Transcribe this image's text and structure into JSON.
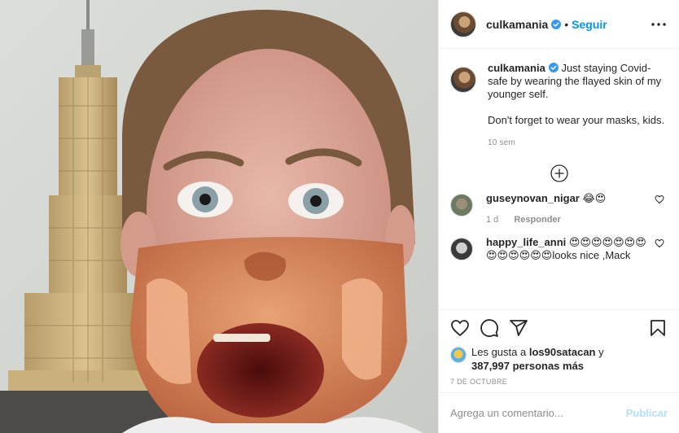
{
  "header": {
    "username": "culkamania",
    "separator": "•",
    "follow_label": "Seguir"
  },
  "caption": {
    "username": "culkamania",
    "text_line1": "Just staying Covid-safe by wearing the flayed skin of my younger self.",
    "text_line2": "Don't forget to wear your masks, kids.",
    "age": "10 sem"
  },
  "comments": [
    {
      "username": "guseynovan_nigar",
      "text": "😂😍",
      "age": "1 d",
      "reply_label": "Responder"
    },
    {
      "username": "happy_life_anni",
      "text": "😍😍😍😍😍😍😍😍😍😍😍😍😍looks nice ,Mack"
    }
  ],
  "likes": {
    "prefix": "Les gusta a ",
    "user": "los90satacan",
    "suffix": " y",
    "count": "387,997 personas más"
  },
  "post_date": "7 DE OCTUBRE",
  "add_comment": {
    "placeholder": "Agrega un comentario...",
    "publish_label": "Publicar"
  },
  "colors": {
    "accent": "#0095f6",
    "publish_disabled": "#b2dffc",
    "muted": "#8e8e8e",
    "text": "#262626"
  },
  "icons": [
    "more-icon",
    "verified-icon",
    "add-circle-icon",
    "heart-icon",
    "comment-icon",
    "share-icon",
    "bookmark-icon"
  ]
}
